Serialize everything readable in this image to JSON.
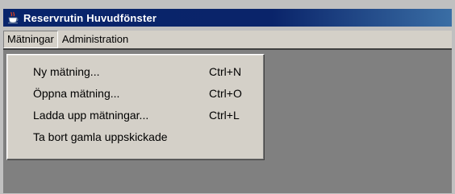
{
  "window": {
    "title": "Reservrutin Huvudfönster",
    "icon": "java-cup-icon"
  },
  "menubar": {
    "items": [
      {
        "label": "Mätningar",
        "active": true
      },
      {
        "label": "Administration",
        "active": false
      }
    ]
  },
  "dropdown": {
    "items": [
      {
        "label": "Ny mätning...",
        "shortcut": "Ctrl+N"
      },
      {
        "label": "Öppna mätning...",
        "shortcut": "Ctrl+O"
      },
      {
        "label": "Ladda upp mätningar...",
        "shortcut": "Ctrl+L"
      },
      {
        "label": "Ta bort gamla uppskickade",
        "shortcut": ""
      }
    ]
  },
  "colors": {
    "titlebar": "#0a246a",
    "face": "#d4d0c8",
    "client": "#808080"
  }
}
